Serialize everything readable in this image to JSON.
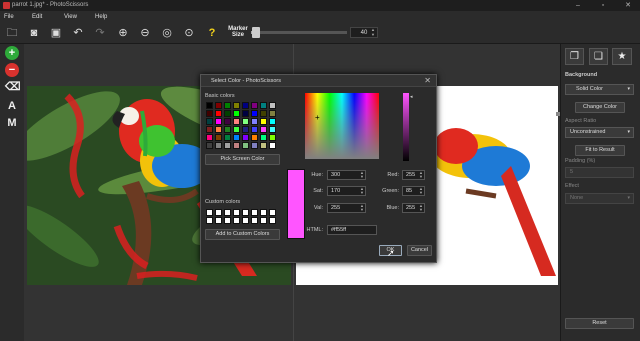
{
  "window": {
    "title": "parrot 1.jpg* - PhotoScissors"
  },
  "menu": [
    "File",
    "Edit",
    "View",
    "Help"
  ],
  "toolbar": {
    "marker_label": "Marker Size",
    "marker_value": "40",
    "marker_fraction": 0.06
  },
  "lefttools": {
    "text_tool": "A",
    "mask_tool": "M"
  },
  "rightpanel": {
    "background_label": "Background",
    "background_select": "Solid Color",
    "change_color": "Change Color",
    "aspect_label": "Aspect Ratio",
    "aspect_select": "Unconstrained",
    "fit_result": "Fit to Result",
    "padding_label": "Padding (%)",
    "padding_value": "5",
    "effect_label": "Effect",
    "effect_select": "None",
    "reset": "Reset"
  },
  "dialog": {
    "title": "Select Color - PhotoScissors",
    "basic_colors_label": "Basic colors",
    "pick_screen": "Pick Screen Color",
    "custom_colors_label": "Custom colors",
    "add_custom": "Add to Custom Colors",
    "hue_label": "Hue:",
    "hue": "300",
    "sat_label": "Sat:",
    "sat": "170",
    "val_label": "Val:",
    "val": "255",
    "red_label": "Red:",
    "red": "255",
    "green_label": "Green:",
    "green": "85",
    "blue_label": "Blue:",
    "blue": "255",
    "html_label": "HTML:",
    "html": "#ff55ff",
    "ok": "OK",
    "cancel": "Cancel",
    "current_color": "#ff55ff"
  },
  "basic_colors": [
    "#000000",
    "#800000",
    "#008000",
    "#808000",
    "#000080",
    "#800080",
    "#008080",
    "#c0c0c0",
    "#400000",
    "#ff0000",
    "#004000",
    "#00ff00",
    "#000040",
    "#0000ff",
    "#404000",
    "#808040",
    "#004040",
    "#ff00ff",
    "#400040",
    "#ff8080",
    "#80ff80",
    "#8080ff",
    "#ffff00",
    "#00ffff",
    "#802020",
    "#ff8040",
    "#208020",
    "#40ff40",
    "#202080",
    "#4040ff",
    "#ff40ff",
    "#40ffff",
    "#ff0080",
    "#804000",
    "#008040",
    "#0080ff",
    "#8000ff",
    "#ff8000",
    "#00ff80",
    "#80ff00",
    "#404040",
    "#808080",
    "#a0a0a0",
    "#c08080",
    "#80c080",
    "#8080c0",
    "#c0c080",
    "#ffffff"
  ]
}
